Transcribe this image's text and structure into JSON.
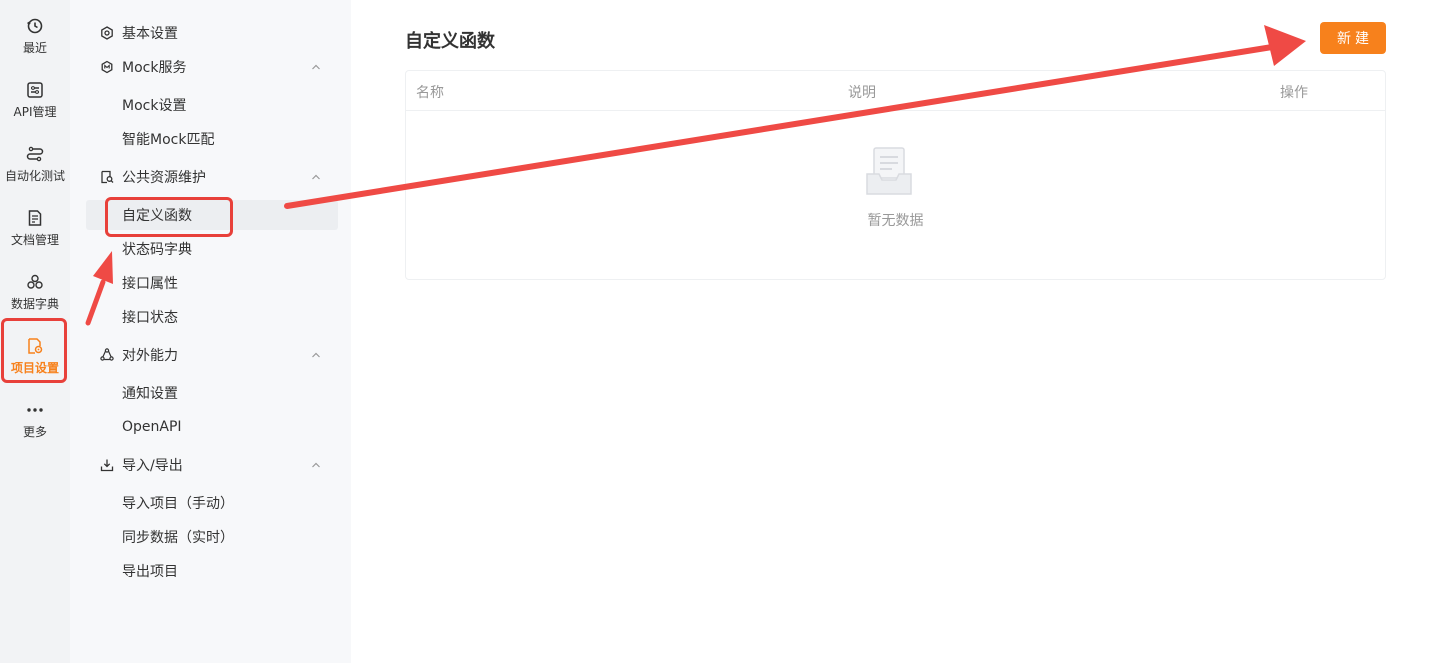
{
  "rail": {
    "items": [
      {
        "label": "最近",
        "icon": "history-icon"
      },
      {
        "label": "API管理",
        "icon": "api-icon"
      },
      {
        "label": "自动化测试",
        "icon": "automation-icon"
      },
      {
        "label": "文档管理",
        "icon": "document-icon"
      },
      {
        "label": "数据字典",
        "icon": "data-dictionary-icon"
      },
      {
        "label": "项目设置",
        "icon": "project-settings-icon"
      },
      {
        "label": "更多",
        "icon": "more-icon"
      }
    ],
    "active": "项目设置"
  },
  "subnav": {
    "basic": "基本设置",
    "mock": {
      "label": "Mock服务",
      "items": [
        "Mock设置",
        "智能Mock匹配"
      ]
    },
    "public": {
      "label": "公共资源维护",
      "items": [
        "自定义函数",
        "状态码字典",
        "接口属性",
        "接口状态"
      ]
    },
    "external": {
      "label": "对外能力",
      "items": [
        "通知设置",
        "OpenAPI"
      ]
    },
    "io": {
      "label": "导入/导出",
      "items": [
        "导入项目（手动）",
        "同步数据（实时）",
        "导出项目"
      ]
    }
  },
  "main": {
    "title": "自定义函数",
    "new_button": "新建",
    "table": {
      "columns": [
        "名称",
        "说明",
        "操作"
      ],
      "empty_text": "暂无数据"
    }
  },
  "colors": {
    "accent": "#f7811c",
    "annotation": "#e8403a"
  }
}
